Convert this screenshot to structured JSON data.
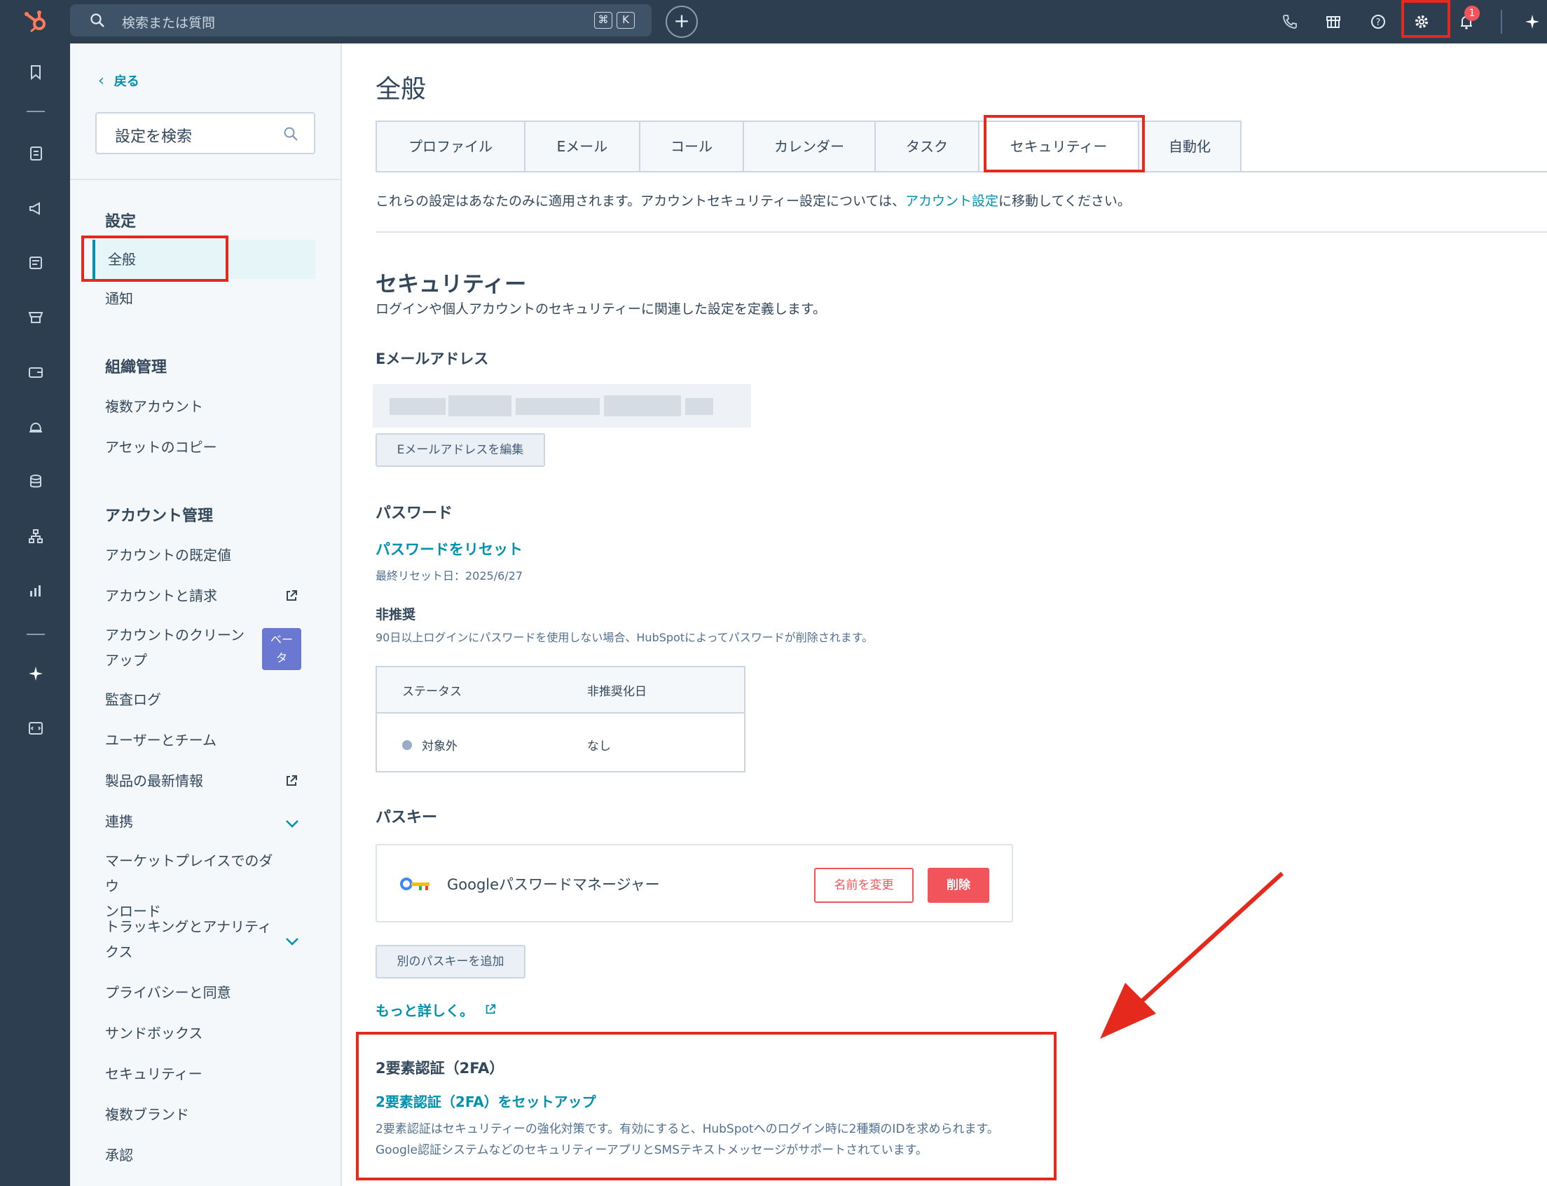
{
  "search": {
    "placeholder": "検索または質問",
    "shortcut_keys": [
      "⌘",
      "K"
    ]
  },
  "topbar": {
    "icons": [
      "phone-icon",
      "marketplace-icon",
      "help-icon",
      "gear-icon",
      "bell-icon",
      "sparkle-icon"
    ],
    "notification_count": "1"
  },
  "rail": {
    "icons": [
      "bookmark-icon",
      "contacts-icon",
      "megaphone-icon",
      "content-icon",
      "sales-icon",
      "commerce-icon",
      "service-icon",
      "data-icon",
      "automation-icon",
      "reports-icon",
      "ai-sparkle-icon",
      "dev-icon"
    ]
  },
  "settings_nav": {
    "back": "戻る",
    "search_placeholder": "設定を検索",
    "section_settings": "設定",
    "item_general": "全般",
    "item_notifications": "通知",
    "section_org": "組織管理",
    "item_multi_accounts": "複数アカウント",
    "item_asset_copy": "アセットのコピー",
    "section_account": "アカウント管理",
    "item_defaults": "アカウントの既定値",
    "item_billing": "アカウントと請求",
    "item_cleanup_1": "アカウントのクリーン",
    "item_cleanup_2": "アップ",
    "beta_1": "ベー",
    "beta_2": "タ",
    "item_audit": "監査ログ",
    "item_users": "ユーザーとチーム",
    "item_updates": "製品の最新情報",
    "item_integrations": "連携",
    "item_marketplace_1": "マーケットプレイスでのダウ",
    "item_marketplace_2": "ンロード",
    "item_tracking_1": "トラッキングとアナリティ",
    "item_tracking_2": "クス",
    "item_privacy": "プライバシーと同意",
    "item_sandbox": "サンドボックス",
    "item_security": "セキュリティー",
    "item_brands": "複数ブランド",
    "item_approvals": "承認"
  },
  "main": {
    "title": "全般",
    "tabs": [
      "プロファイル",
      "Eメール",
      "コール",
      "カレンダー",
      "タスク",
      "セキュリティー",
      "自動化"
    ],
    "info_before": "これらの設定はあなたのみに適用されます。アカウントセキュリティー設定については、",
    "info_link": "アカウント設定",
    "info_after": "に移動してください。",
    "security_title": "セキュリティー",
    "security_desc": "ログインや個人アカウントのセキュリティーに関連した設定を定義します。",
    "email_label": "Eメールアドレス",
    "email_edit_button": "Eメールアドレスを編集",
    "password_label": "パスワード",
    "password_reset_link": "パスワードをリセット",
    "password_last_reset": "最終リセット日：2025/6/27",
    "deprecated_label": "非推奨",
    "deprecated_desc": "90日以上ログインにパスワードを使用しない場合、HubSpotによってパスワードが削除されます。",
    "table": {
      "headers": [
        "ステータス",
        "非推奨化日"
      ],
      "row": [
        "対象外",
        "なし"
      ]
    },
    "passkey_label": "パスキー",
    "passkey_name": "Googleパスワードマネージャー",
    "rename_button": "名前を変更",
    "delete_button": "削除",
    "add_passkey_button": "別のパスキーを追加",
    "learn_more": "もっと詳しく。",
    "tfa_title": "2要素認証（2FA）",
    "tfa_setup_link": "2要素認証（2FA）をセットアップ",
    "tfa_desc": "2要素認証はセキュリティーの強化対策です。有効にすると、HubSpotへのログイン時に2種類のIDを求められます。Google認証システムなどのセキュリティーアプリとSMSテキストメッセージがサポートされています。"
  },
  "colors": {
    "accent": "#0091ae",
    "highlight": "#e52a1d",
    "nav_dark": "#2d3e50",
    "danger": "#f2545b"
  }
}
